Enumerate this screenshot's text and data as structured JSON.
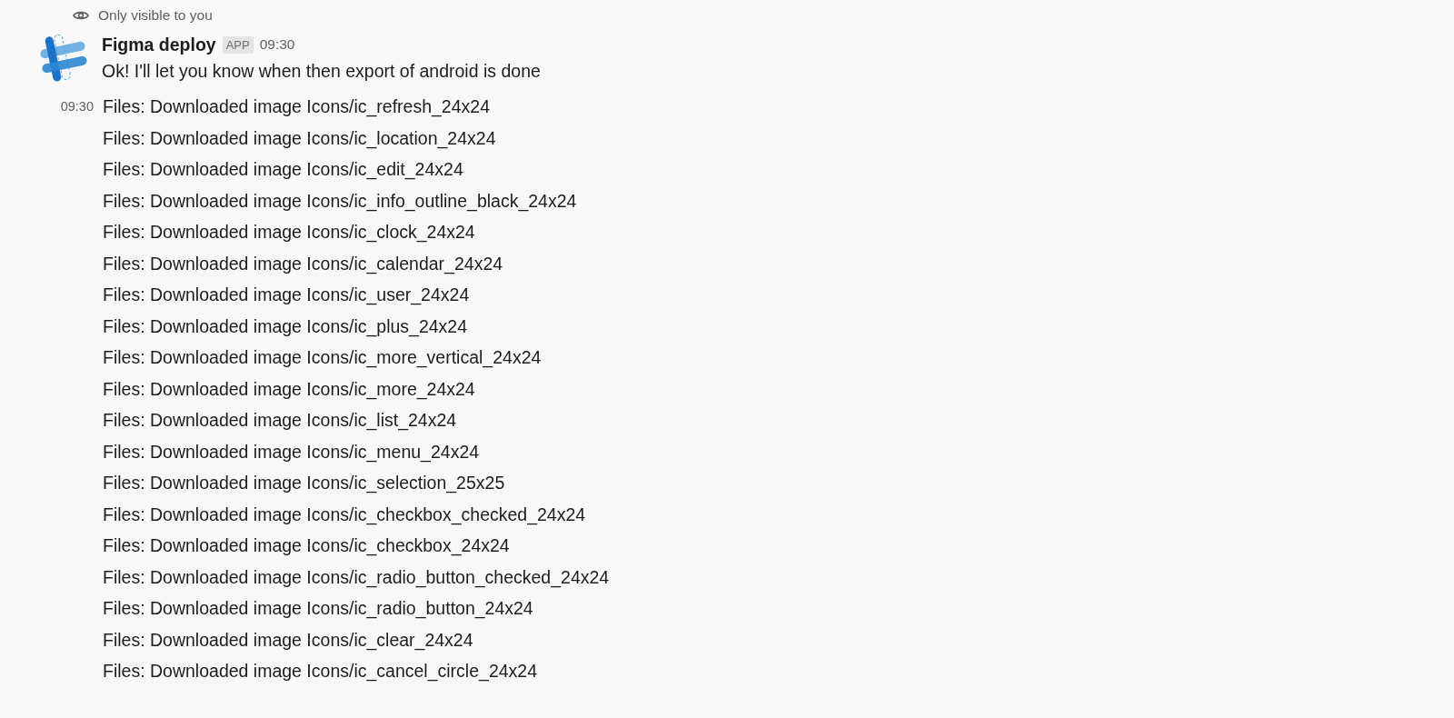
{
  "ephemeral_note": "Only visible to you",
  "message": {
    "author": "Figma deploy",
    "badge": "APP",
    "time": "09:30",
    "text": "Ok! I'll let you know when then export of android is done"
  },
  "followup": {
    "time": "09:30",
    "lines": [
      "Files: Downloaded image Icons/ic_refresh_24x24",
      "Files: Downloaded image Icons/ic_location_24x24",
      "Files: Downloaded image Icons/ic_edit_24x24",
      "Files: Downloaded image Icons/ic_info_outline_black_24x24",
      "Files: Downloaded image Icons/ic_clock_24x24",
      "Files: Downloaded image Icons/ic_calendar_24x24",
      "Files: Downloaded image Icons/ic_user_24x24",
      "Files: Downloaded image Icons/ic_plus_24x24",
      "Files: Downloaded image Icons/ic_more_vertical_24x24",
      "Files: Downloaded image Icons/ic_more_24x24",
      "Files: Downloaded image Icons/ic_list_24x24",
      "Files: Downloaded image Icons/ic_menu_24x24",
      "Files: Downloaded image Icons/ic_selection_25x25",
      "Files: Downloaded image Icons/ic_checkbox_checked_24x24",
      "Files: Downloaded image Icons/ic_checkbox_24x24",
      "Files: Downloaded image Icons/ic_radio_button_checked_24x24",
      "Files: Downloaded image Icons/ic_radio_button_24x24",
      "Files: Downloaded image Icons/ic_clear_24x24",
      "Files: Downloaded image Icons/ic_cancel_circle_24x24"
    ]
  }
}
